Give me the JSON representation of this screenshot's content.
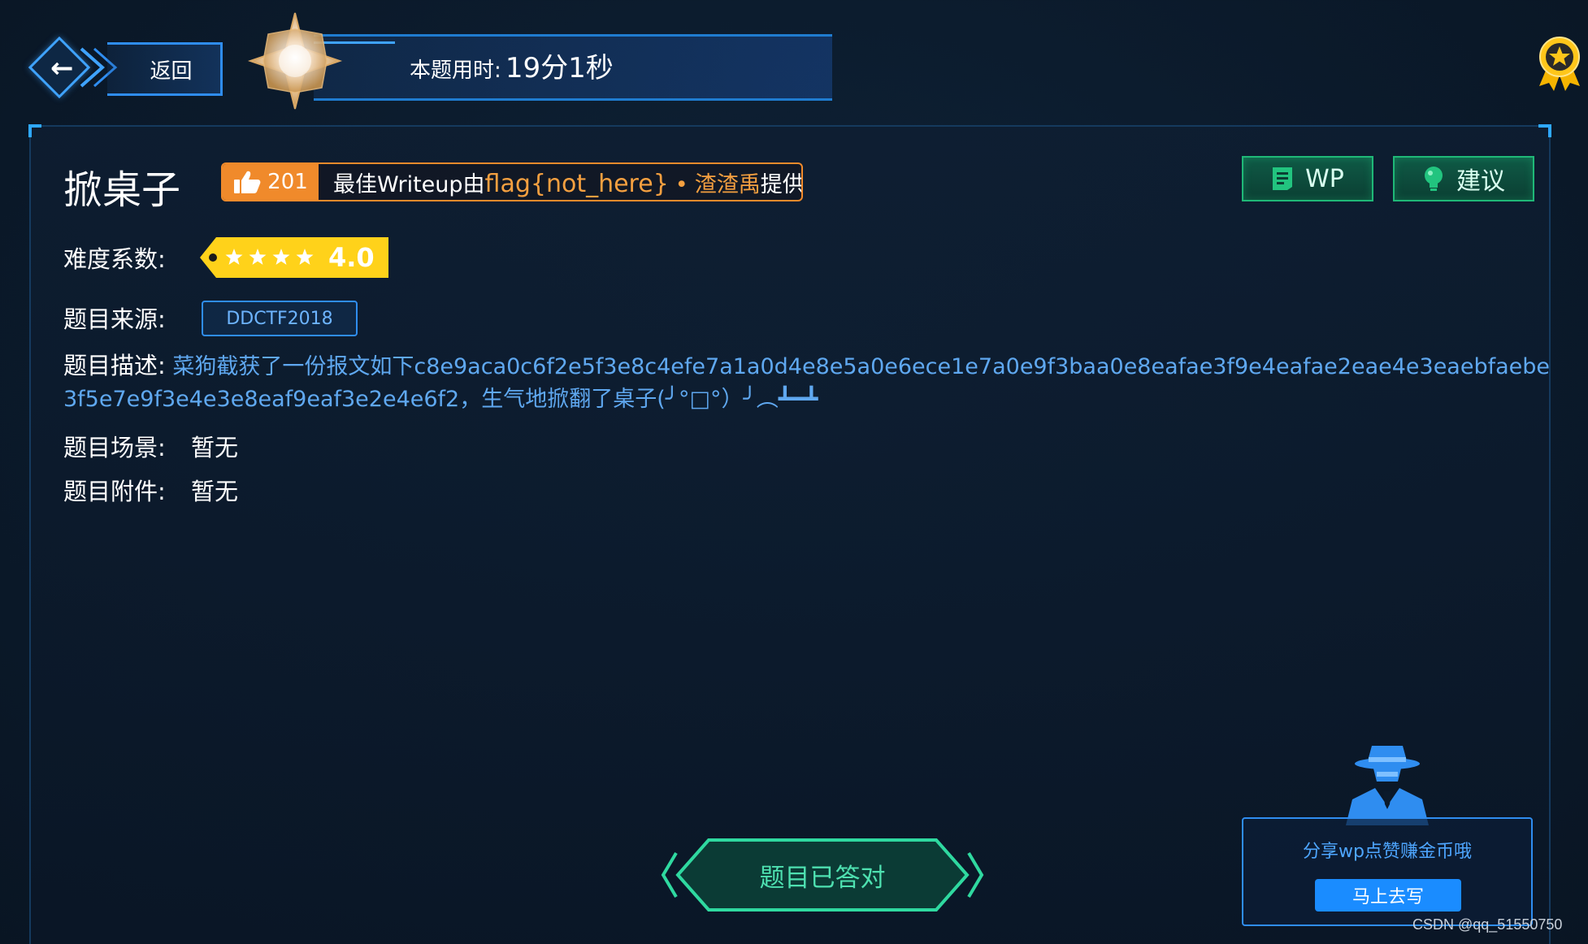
{
  "header": {
    "back_label": "返回",
    "timer_label": "本题用时:",
    "timer_value": "19分1秒"
  },
  "challenge": {
    "title": "掀桌子",
    "likes": "201",
    "writeup_prefix": "最佳Writeup由",
    "writeup_flag": "flag{not_here}",
    "writeup_dot": "•",
    "writeup_author": "渣渣禹",
    "writeup_suffix": "提供",
    "wp_button": "WP",
    "suggest_button": "建议",
    "difficulty_label": "难度系数:",
    "difficulty_value": "4.0",
    "difficulty_stars": 4,
    "source_label": "题目来源:",
    "source_value": "DDCTF2018",
    "desc_label": "题目描述:",
    "desc_text": "菜狗截获了一份报文如下c8e9aca0c6f2e5f3e8c4efe7a1a0d4e8e5a0e6ece1e7a0e9f3baa0e8eafae3f9e4eafae2eae4e3eaebfaebe3f5e7e9f3e4e3e8eaf9eaf3e2e4e6f2，生气地掀翻了桌子(╯°□°）╯︵┻━┻",
    "scene_label": "题目场景:",
    "scene_value": "暂无",
    "attach_label": "题目附件:",
    "attach_value": "暂无"
  },
  "footer": {
    "answered_label": "题目已答对",
    "share_msg": "分享wp点赞赚金币哦",
    "share_button": "马上去写",
    "watermark": "CSDN @qq_51550750"
  },
  "colors": {
    "accent_blue": "#2f8df0",
    "writeup_orange": "#f08a2b",
    "green_button": "#1fb877",
    "difficulty_yellow": "#ffd21a",
    "answered_teal": "#4ee0b0"
  },
  "icons": {
    "back": "arrow-left-icon",
    "medal": "compass-star-icon",
    "award": "award-ribbon-icon",
    "like": "thumbs-up-icon",
    "wp": "document-icon",
    "suggest": "lightbulb-icon",
    "star": "star-icon",
    "spy": "detective-icon"
  }
}
